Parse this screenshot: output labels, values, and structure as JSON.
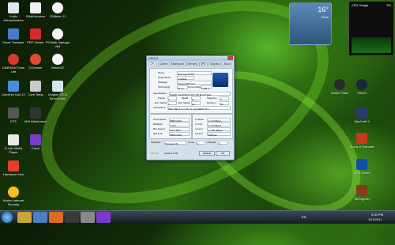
{
  "desktop": {
    "icons_left": [
      {
        "label": "Kodiz Autoactivators"
      },
      {
        "label": "Driver Sweeper"
      },
      {
        "label": "DAEMON Tools Lite"
      },
      {
        "label": "LiberKey Unit 12"
      },
      {
        "label": "ETS"
      },
      {
        "label": "K-Lite Media Player"
      },
      {
        "label": "Hardware Mon"
      },
      {
        "label": "Norton Internet Security"
      }
    ],
    "icons_col2": [
      {
        "label": "IObitUnlocker"
      },
      {
        "label": "PDF-Viewer"
      },
      {
        "label": "CCleaner"
      },
      {
        "label": "Core Temp"
      },
      {
        "label": "MSI Afterburner"
      },
      {
        "label": "Crack"
      },
      {
        "label": "Realtek"
      },
      {
        "label": "Video"
      }
    ],
    "icons_col3": [
      {
        "label": "JDMeter 11"
      },
      {
        "label": "PCMark Vantage x64"
      },
      {
        "label": "Bench12"
      },
      {
        "label": "Unigine DX11 Benchmark"
      }
    ],
    "icons_right": [
      {
        "label": "Adobe Flash"
      },
      {
        "label": "Steam"
      },
      {
        "label": "StarCraft II"
      },
      {
        "label": "World of Warcraft"
      },
      {
        "label": "FIFA Online"
      },
      {
        "label": "Stronghold"
      }
    ],
    "weather_gadget": {
      "temp": "16°",
      "condition": "Clear"
    },
    "cpu_gadget": {
      "title": "CPU Usage",
      "value": "2%"
    }
  },
  "cpuz": {
    "window_title": "CPU-Z",
    "tabs": [
      "CPU",
      "Caches",
      "Mainboard",
      "Memory",
      "SPD",
      "Graphics",
      "About"
    ],
    "processor": {
      "name": "Intel Core i5 750",
      "code_name": "Lynnfield",
      "package": "Socket 1156 LGA",
      "technology": "45 nm",
      "voltage": "1.088 V",
      "specification": "Intel(R) Core(TM) i5 CPU 750 @ 2.67GHz",
      "family": "6",
      "model": "E",
      "stepping": "5",
      "ext_family": "6",
      "ext_model": "1E",
      "revision": "B1",
      "instructions": "MMX, SSE (1, 2, 3, 3S, 4.1, 4.2), EM64T, VT-x"
    },
    "clocks": {
      "core_speed": "3989.9 MHz",
      "multiplier": "x 20.0",
      "bus_speed": "199.5 MHz",
      "qpi_link": "3589.9 MHz"
    },
    "cache": {
      "l1d": "4 x 32 KBytes",
      "l1i": "4 x 32 KBytes",
      "l2": "4 x 256 KBytes",
      "l3": "8 MBytes"
    },
    "selection": "Processor #1",
    "cores": "4",
    "threads": "4",
    "version": "Version 1.58",
    "validate_label": "Validate",
    "ok_label": "OK"
  },
  "taskbar": {
    "time": "9:20 PM",
    "date": "11/1/2011",
    "lang": "EN"
  }
}
